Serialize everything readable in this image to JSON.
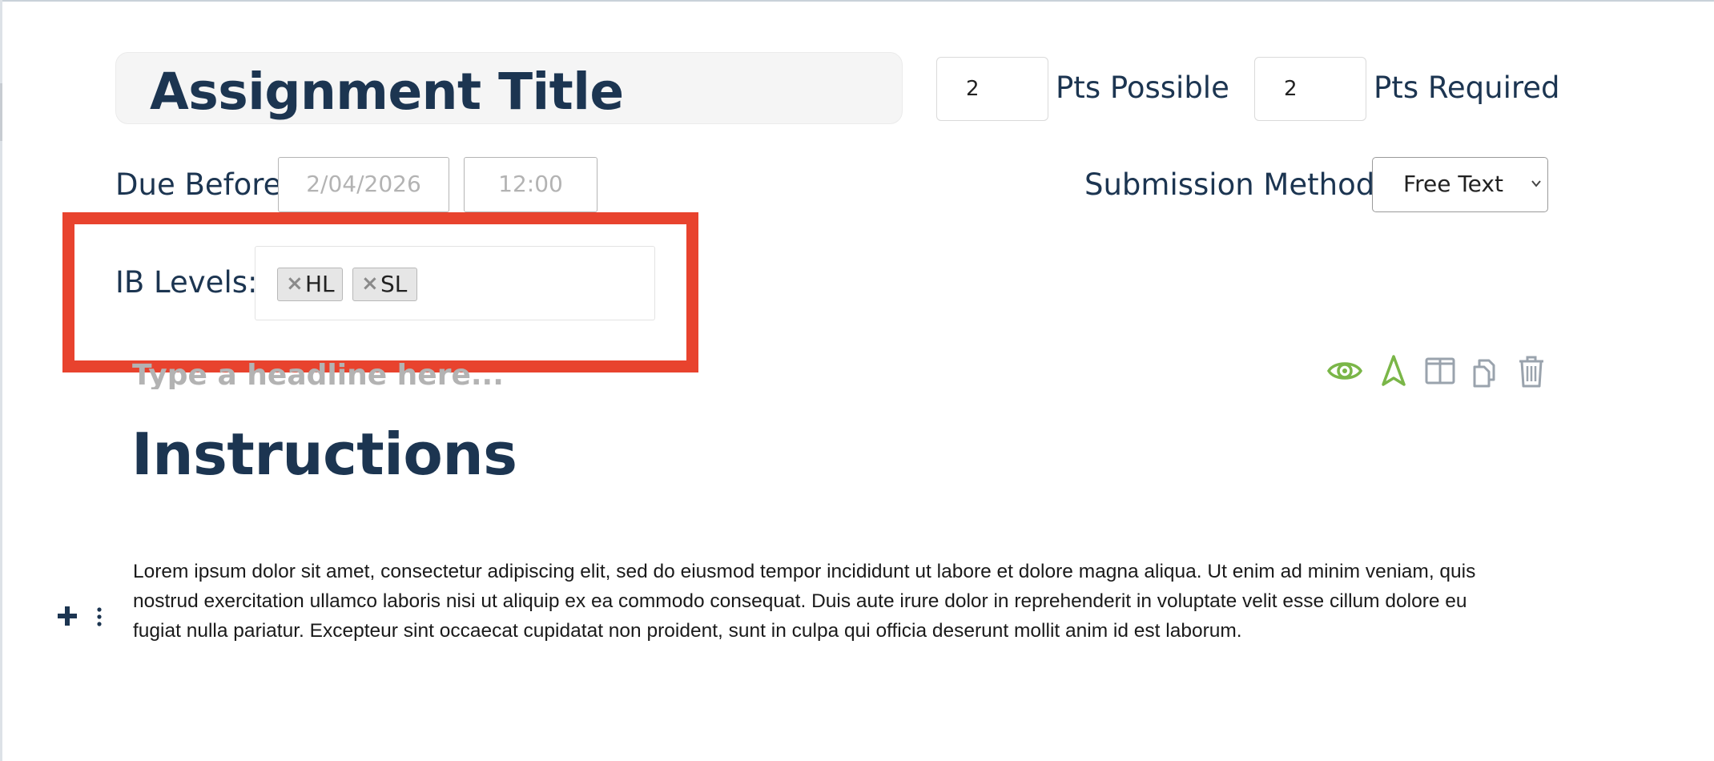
{
  "assignment": {
    "title": "Assignment Title",
    "pts_possible_value": "2",
    "pts_possible_label": "Pts Possible",
    "pts_required_value": "2",
    "pts_required_label": "Pts Required"
  },
  "due": {
    "label": "Due Before",
    "date_placeholder": "2/04/2026",
    "time_placeholder": "12:00"
  },
  "submission": {
    "label": "Submission Method:",
    "selected": "Free Text"
  },
  "ib_levels": {
    "label": "IB Levels:",
    "remove_glyph": "×",
    "tags": [
      "HL",
      "SL"
    ]
  },
  "editor": {
    "headline_placeholder": "Type a headline here...",
    "heading": "Instructions",
    "body": "Lorem ipsum dolor sit amet, consectetur adipiscing elit, sed do eiusmod tempor incididunt ut labore et dolore magna aliqua. Ut enim ad minim veniam, quis nostrud exercitation ullamco laboris nisi ut aliquip ex ea commodo consequat. Duis aute irure dolor in reprehenderit in voluptate velit esse cillum dolore eu fugiat nulla pariatur. Excepteur sint occaecat cupidatat non proident, sunt in culpa qui officia deserunt mollit anim id est laborum.",
    "toolbar_icons": [
      "eye-icon",
      "navigation-arrow-icon",
      "columns-icon",
      "copy-icon",
      "trash-icon"
    ],
    "block_icons": [
      "plus-icon",
      "drag-handle-icon"
    ]
  },
  "colors": {
    "heading": "#1c3551",
    "accent_green": "#7ab648",
    "icon_gray": "#9aa3ad",
    "highlight": "#e8432e"
  }
}
